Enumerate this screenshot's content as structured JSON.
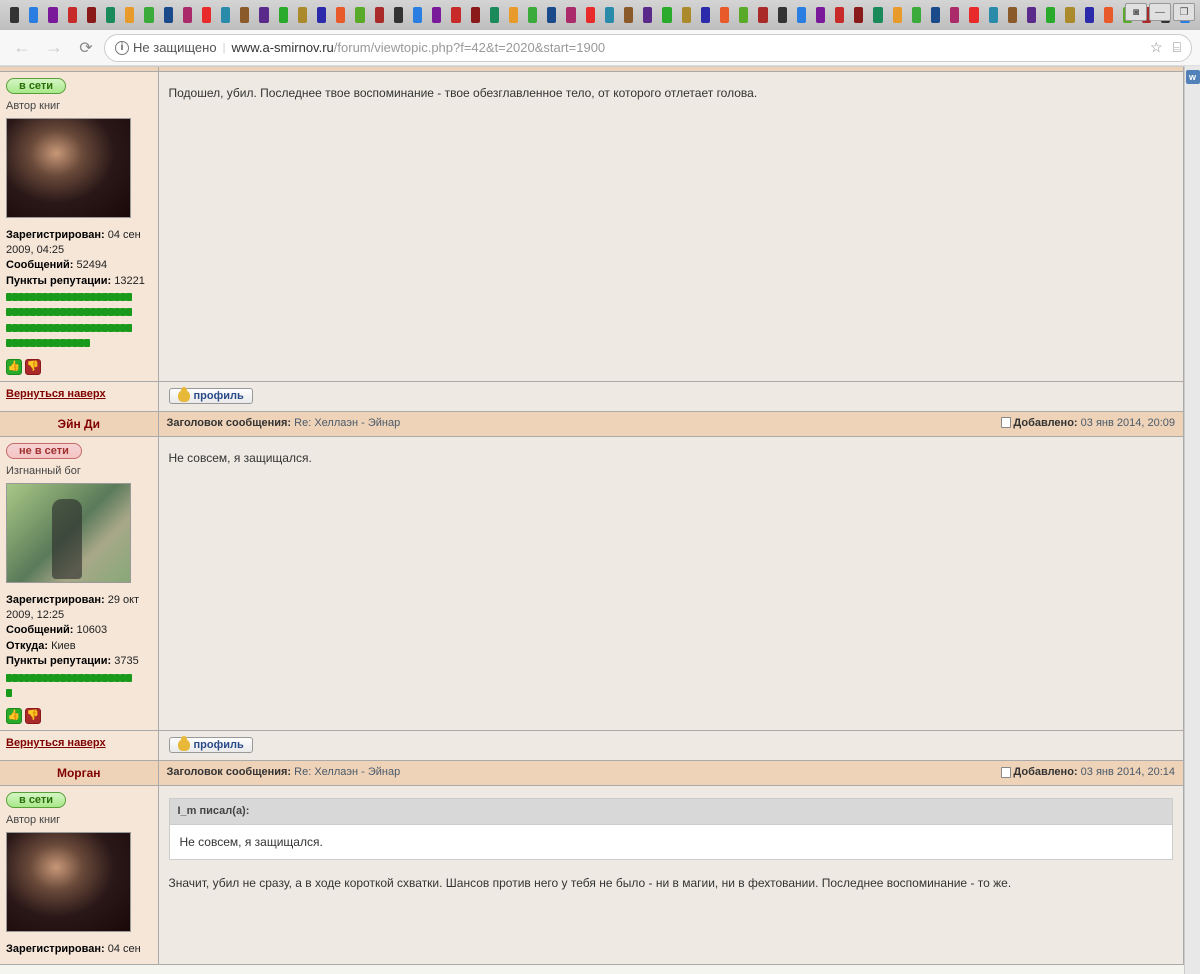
{
  "browser": {
    "insecure_label": "Не защищено",
    "url_host": "www.a-smirnov.ru",
    "url_path": "/forum/viewtopic.php?f=42&t=2020&start=1900"
  },
  "labels": {
    "subject": "Заголовок сообщения:",
    "posted": "Добавлено:",
    "registered": "Зарегистрирован:",
    "posts": "Сообщений:",
    "from": "Откуда:",
    "rep_points": "Пункты репутации:",
    "back_to_top": "Вернуться наверх",
    "profile_btn": "профиль",
    "online": "в сети",
    "offline": "не в сети"
  },
  "posts": [
    {
      "author": "",
      "status": "online",
      "rank": "Автор книг",
      "avatar": "morgan",
      "registered": "04 сен 2009, 04:25",
      "post_count": "52494",
      "from": "",
      "rep": "13221",
      "rep_rows": [
        21,
        21,
        21,
        14
      ],
      "subject": "",
      "posted": "",
      "show_header": false,
      "body": "Подошел, убил. Последнее твое воспоминание - твое обезглавленное тело, от которого отлетает голова.",
      "quote": null
    },
    {
      "author": "Эйн Ди",
      "status": "offline",
      "rank": "Изгнанный бог",
      "avatar": "eyndi",
      "registered": "29 окт 2009, 12:25",
      "post_count": "10603",
      "from": "Киев",
      "rep": "3735",
      "rep_rows": [
        21,
        1
      ],
      "subject": "Re: Хеллаэн - Эйнар",
      "posted": "03 янв 2014, 20:09",
      "show_header": true,
      "body": "Не совсем, я защищался.",
      "quote": null
    },
    {
      "author": "Морган",
      "status": "online",
      "rank": "Автор книг",
      "avatar": "morgan",
      "registered": "04 сен",
      "post_count": "",
      "from": "",
      "rep": "",
      "rep_rows": [],
      "subject": "Re: Хеллаэн - Эйнар",
      "posted": "03 янв 2014, 20:14",
      "show_header": true,
      "body": "Значит, убил не сразу, а в ходе короткой схватки. Шансов против него у тебя не было - ни в магии, ни в фехтовании. Последнее воспоминание - то же.",
      "quote": {
        "author": "I_m писал(а):",
        "text": "Не совсем, я защищался."
      },
      "truncated": true
    }
  ]
}
